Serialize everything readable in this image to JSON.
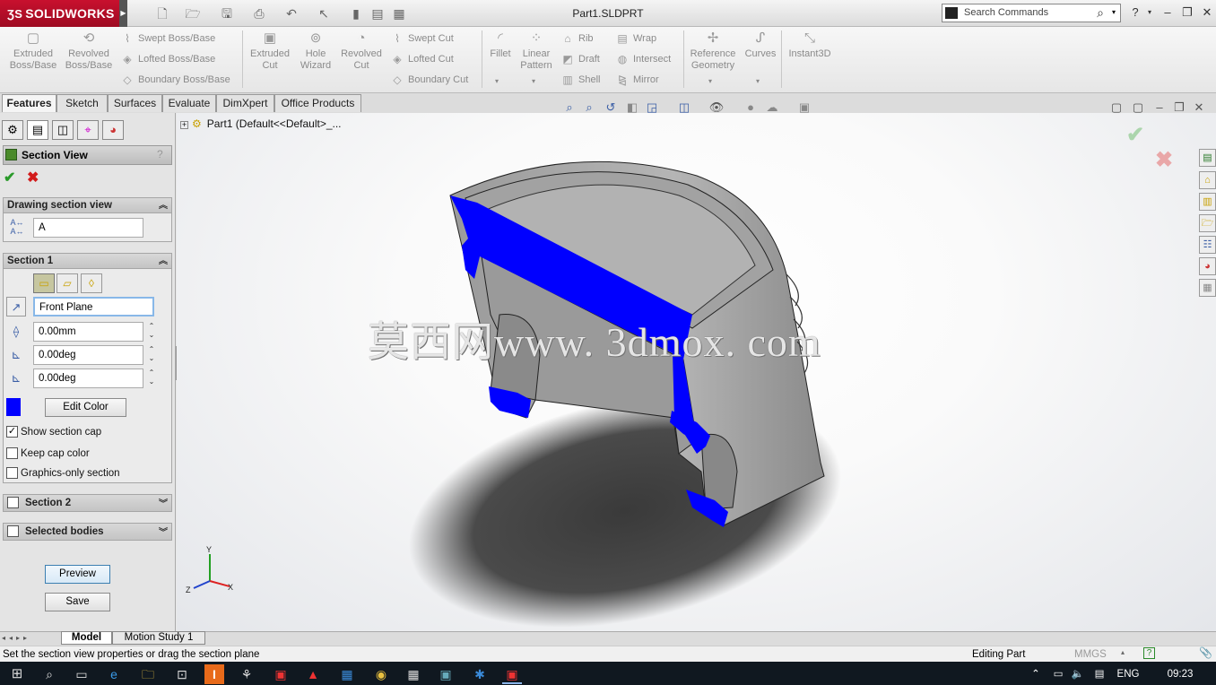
{
  "app": {
    "brand": "SOLIDWORKS",
    "document_title": "Part1.SLDPRT",
    "search_placeholder": "Search Commands",
    "help": "?"
  },
  "quick_access": [
    "new-icon",
    "open-icon",
    "save-icon",
    "print-icon",
    "undo-icon",
    "select-icon",
    "rebuild-icon",
    "file-properties-icon",
    "options-icon"
  ],
  "command_manager": {
    "extruded_boss": "Extruded\nBoss/Base",
    "revolved_boss": "Revolved\nBoss/Base",
    "swept_boss": "Swept Boss/Base",
    "lofted_boss": "Lofted Boss/Base",
    "boundary_boss": "Boundary Boss/Base",
    "extruded_cut": "Extruded\nCut",
    "hole_wizard": "Hole\nWizard",
    "revolved_cut": "Revolved\nCut",
    "swept_cut": "Swept Cut",
    "lofted_cut": "Lofted Cut",
    "boundary_cut": "Boundary Cut",
    "fillet": "Fillet",
    "linear_pattern": "Linear\nPattern",
    "rib": "Rib",
    "draft": "Draft",
    "shell": "Shell",
    "wrap": "Wrap",
    "intersect": "Intersect",
    "mirror": "Mirror",
    "reference_geometry": "Reference\nGeometry",
    "curves": "Curves",
    "instant3d": "Instant3D"
  },
  "tabs": [
    "Features",
    "Sketch",
    "Surfaces",
    "Evaluate",
    "DimXpert",
    "Office Products"
  ],
  "property_manager": {
    "title": "Section View",
    "help": "?",
    "drawing_section_view": {
      "header": "Drawing section view",
      "name_value": "A"
    },
    "section1": {
      "header": "Section 1",
      "reference_plane": "Front Plane",
      "offset": "0.00mm",
      "rotation_x": "0.00deg",
      "rotation_y": "0.00deg",
      "edit_color": "Edit Color",
      "cap_color": "#0000ff",
      "show_section_cap": "Show section cap",
      "keep_cap_color": "Keep cap color",
      "graphics_only": "Graphics-only section",
      "show_section_cap_checked": true,
      "keep_cap_color_checked": false,
      "graphics_only_checked": false
    },
    "section2": {
      "header": "Section 2"
    },
    "selected_bodies": {
      "header": "Selected bodies"
    },
    "preview": "Preview",
    "save": "Save"
  },
  "feature_tree": {
    "root": "Part1  (Default<<Default>_..."
  },
  "watermark": "莫西网www. 3dmox. com",
  "triad": {
    "y": "Y",
    "x": "X",
    "z": "Z"
  },
  "bottom_tabs": [
    "Model",
    "Motion Study 1"
  ],
  "status": {
    "message": "Set the section view properties or drag the section plane",
    "mode": "Editing Part",
    "units": "MMGS"
  },
  "taskbar": {
    "language": "ENG",
    "time": "09:23"
  },
  "colors": {
    "section_cap": "#0000ff",
    "part": "#a8a8a8",
    "brand": "#c8102e"
  }
}
